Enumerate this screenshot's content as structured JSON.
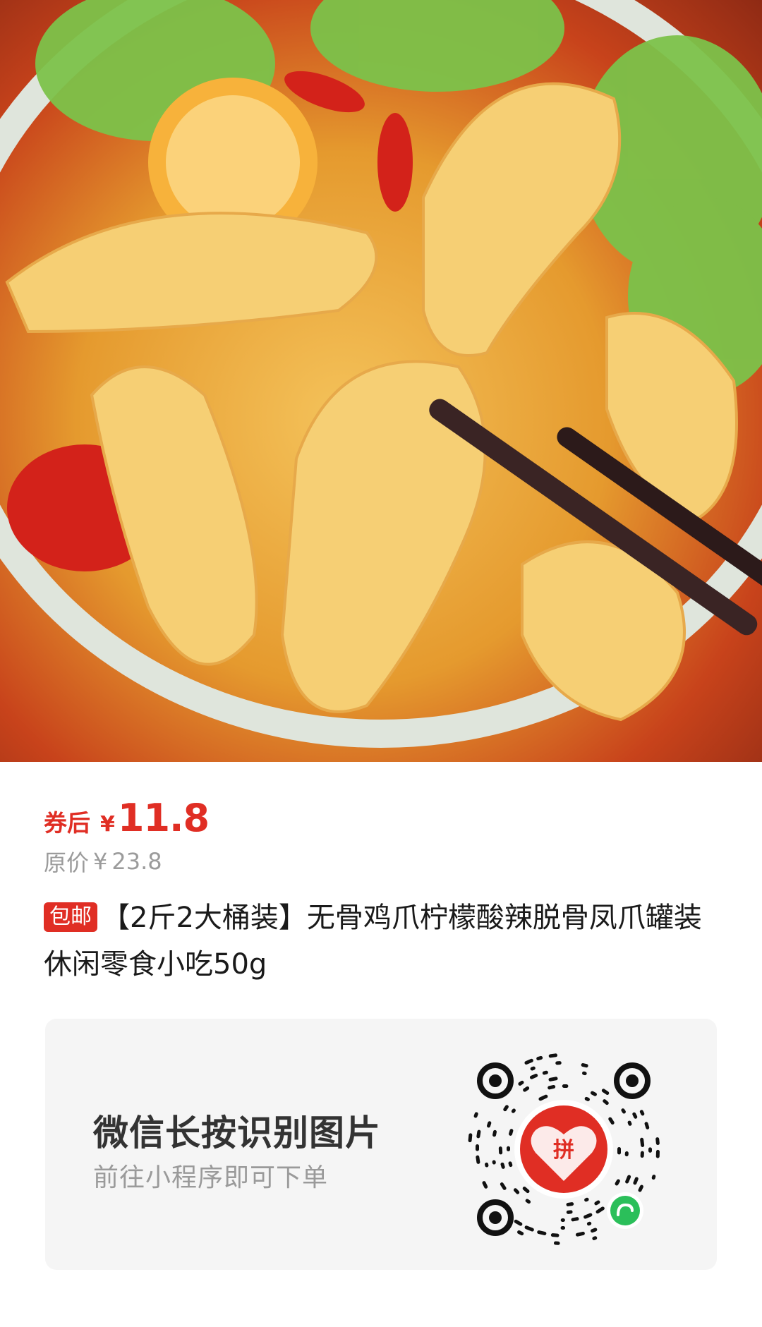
{
  "product": {
    "image_label": "product-photo",
    "coupon_label": "券后",
    "currency_symbol": "¥",
    "price": "11.8",
    "original_label": "原价",
    "original_price": "23.8",
    "badge": "包邮",
    "title": "【2斤2大桶装】无骨鸡爪柠檬酸辣脱骨凤爪罐装休闲零食小吃50g"
  },
  "qr_card": {
    "title": "微信长按识别图片",
    "subtitle": "前往小程序即可下单",
    "logo_char": "拼"
  },
  "colors": {
    "accent": "#e02e24",
    "card_bg": "#f5f5f5",
    "muted_text": "#9b9b9b",
    "wechat_green": "#2bbf5a"
  }
}
